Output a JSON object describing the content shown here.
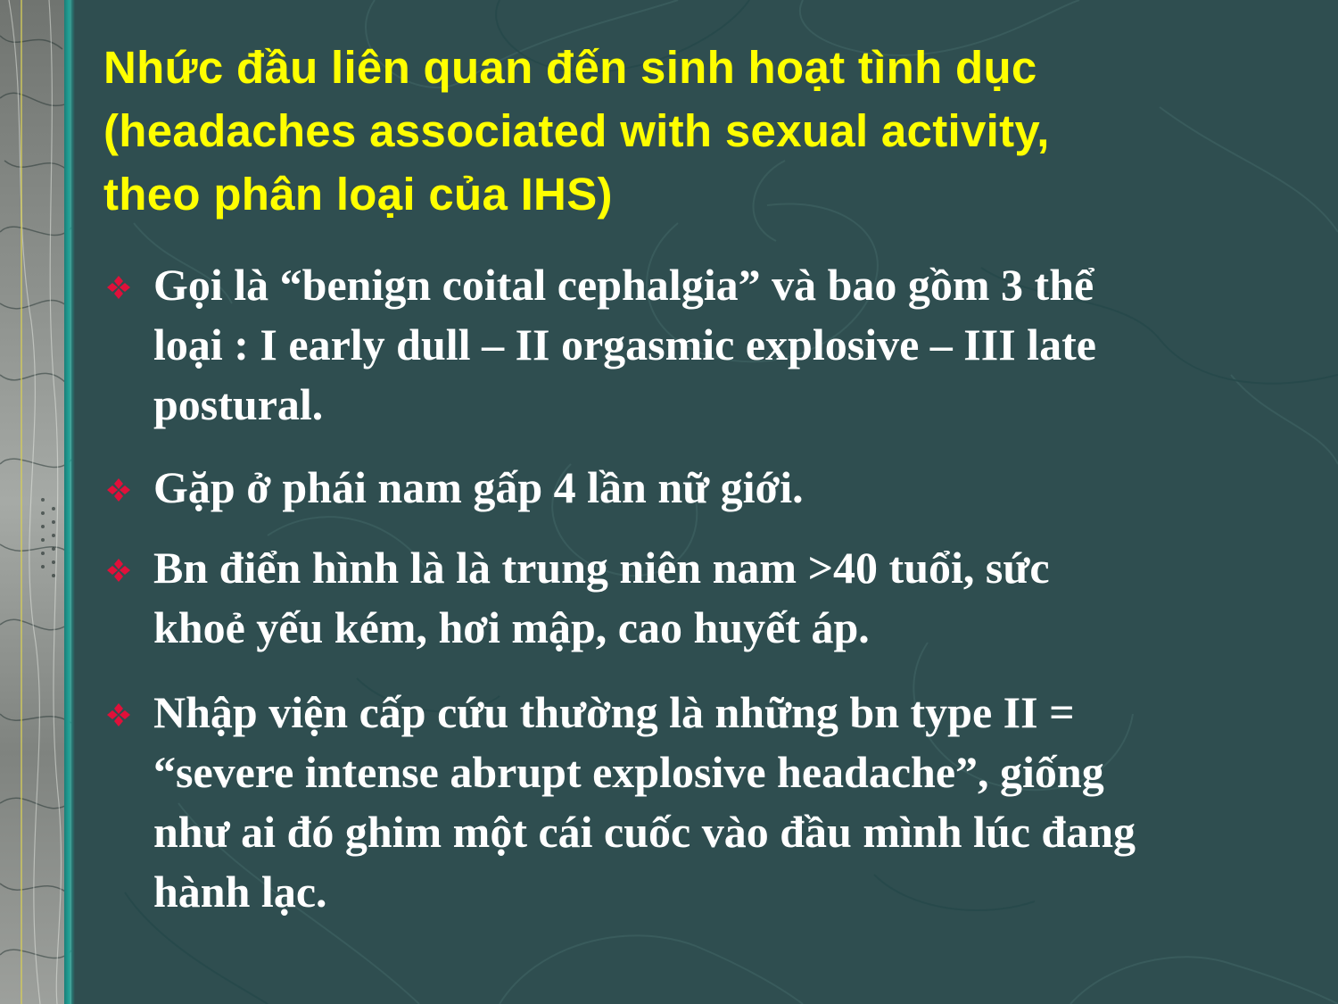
{
  "slide": {
    "title": {
      "lines": [
        "Nhức đầu liên quan đến sinh hoạt tình dục",
        "(headaches associated with sexual activity,",
        "theo phân loại của IHS)"
      ]
    },
    "bullets": [
      {
        "lines": [
          "Gọi là “benign coital cephalgia” và bao gồm 3 thể",
          "loại : I early dull – II orgasmic explosive – III late",
          "postural."
        ]
      },
      {
        "lines": [
          "Gặp ở phái nam gấp 4 lần nữ giới."
        ]
      },
      {
        "lines": [
          "Bn điển hình là là trung niên nam >40 tuổi, sức",
          "khoẻ yếu kém, hơi mập, cao huyết áp."
        ]
      },
      {
        "lines": [
          "Nhập viện cấp cứu thường là những bn type II =",
          "“severe intense abrupt explosive headache”, giống",
          "như ai đó ghim một cái cuốc vào đầu mình lúc đang",
          "hành lạc."
        ]
      }
    ],
    "bullet_icon": "four-diamond-bullet-icon"
  },
  "colors": {
    "background": "#2f4e50",
    "title": "#ffff00",
    "body_text": "#ffffff",
    "bullet_marker": "#e0103a"
  }
}
